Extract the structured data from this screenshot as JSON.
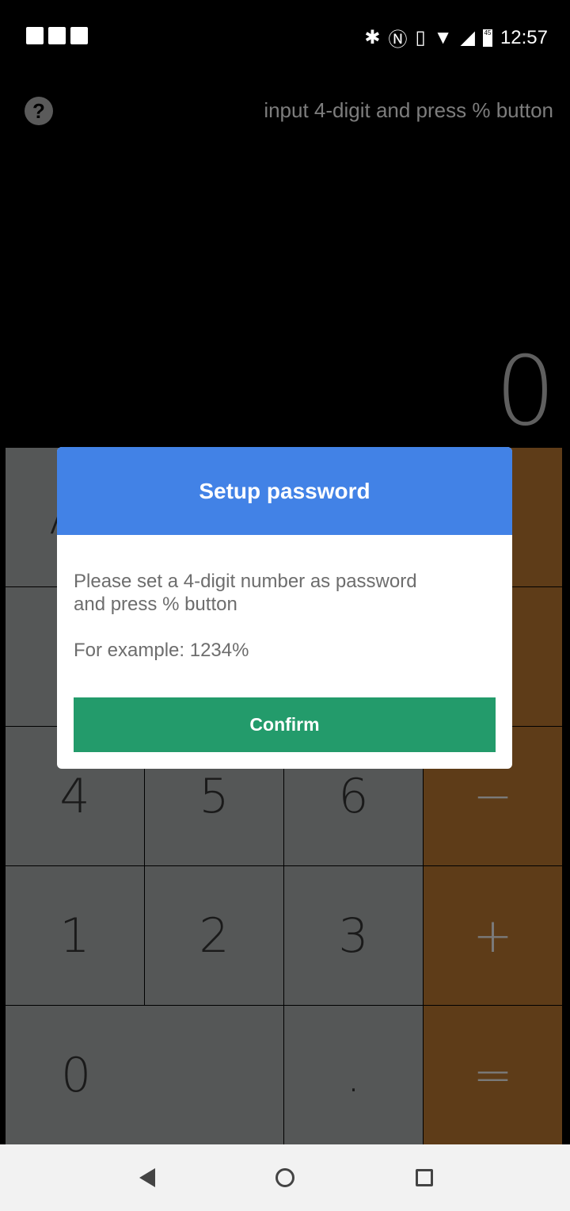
{
  "status_bar": {
    "time": "12:57",
    "battery": "45",
    "left_icons": [
      "news-icon",
      "gmail-icon",
      "image-icon"
    ],
    "right_icons": [
      "bluetooth-icon",
      "nfc-icon",
      "vibrate-icon",
      "wifi-icon",
      "signal-icon",
      "battery-icon"
    ]
  },
  "header": {
    "help_label": "?",
    "hint": "input 4-digit and press % button"
  },
  "display": {
    "value": "0"
  },
  "keypad": {
    "ac": "AC",
    "k4": "4",
    "k5": "5",
    "k6": "6",
    "minus": "−",
    "k1": "1",
    "k2": "2",
    "k3": "3",
    "plus": "+",
    "k0": "0",
    "dot": ".",
    "equals": "="
  },
  "dialog": {
    "title": "Setup password",
    "message": "Please set a 4-digit number as password and press % button",
    "example": "For example: 1234%",
    "confirm_label": "Confirm"
  },
  "colors": {
    "dialog_header": "#4282e6",
    "confirm": "#239b6b",
    "key": "#555757",
    "operator_key": "#5e3c18"
  }
}
